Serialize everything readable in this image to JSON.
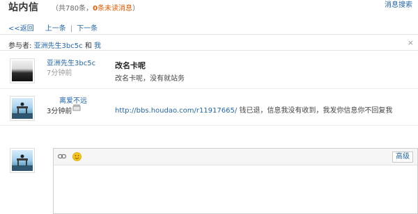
{
  "header": {
    "title": "站内信",
    "count_prefix": "（共780条，",
    "unread_count": "0",
    "unread_text": "条未读消息",
    "count_suffix": "）",
    "search_link": "消息搜索"
  },
  "nav": {
    "back": "<<返回",
    "prev": "上一条",
    "separator": "|",
    "next": "下一条"
  },
  "participants": {
    "label": "参与者:",
    "user": "亚洲先生3bc5c",
    "and": "和",
    "me": "我",
    "close": "×"
  },
  "messages": [
    {
      "sender": "亚洲先生3bc5c",
      "time": "7分钟前",
      "subject": "改名卡呢",
      "body": "改名卡呢，没有就站务"
    },
    {
      "sender": "离爱不远",
      "time": "3分钟前",
      "link": "http://bbs.houdao.com/r11917665/",
      "body": "钱已退，信息我没有收到，我发你信息你不回复我"
    }
  ],
  "composer": {
    "advanced_label": "高级"
  },
  "icons": {
    "link": "link-icon",
    "emoji": "smiley-icon",
    "delete": "trash-icon"
  },
  "colors": {
    "link": "#2366a8",
    "unread": "#e05a00",
    "emoji": "#f5c518"
  }
}
